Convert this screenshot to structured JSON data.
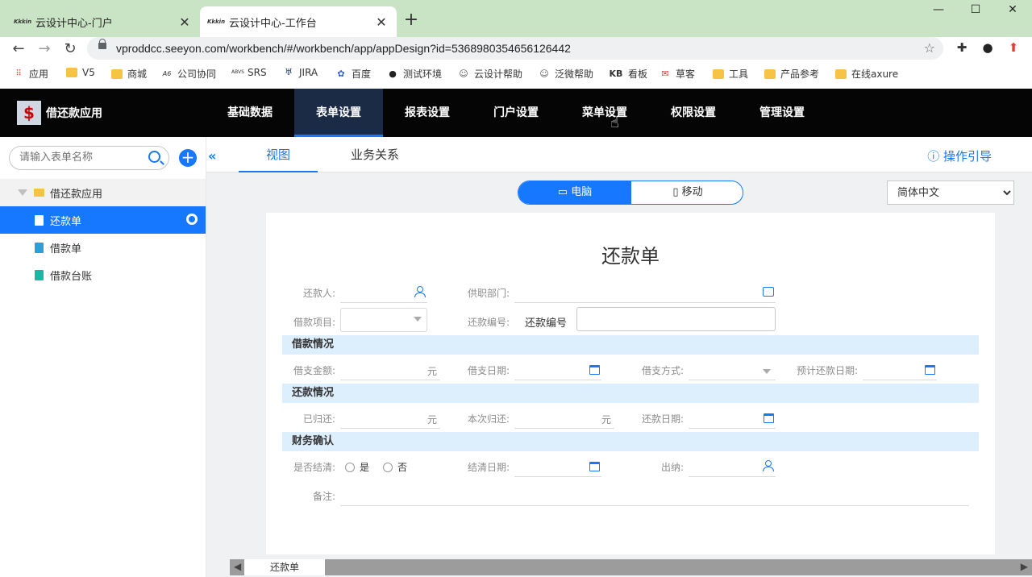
{
  "browser": {
    "tabs": [
      {
        "favicon": "Kkkin",
        "title": "云设计中心-门户",
        "active": false
      },
      {
        "favicon": "Kkkin",
        "title": "云设计中心-工作台",
        "active": true
      }
    ],
    "url": "vproddcc.seeyon.com/workbench/#/workbench/app/appDesign?id=5368980354656126442",
    "bookmarks": [
      {
        "icon": "apps-grid-icon",
        "label": "应用"
      },
      {
        "icon": "folder-icon",
        "label": "V5"
      },
      {
        "icon": "folder-icon",
        "label": "商城"
      },
      {
        "icon": "a6-icon",
        "label": "公司协同"
      },
      {
        "icon": "srs-icon",
        "label": "SRS"
      },
      {
        "icon": "jira-icon",
        "label": "JIRA"
      },
      {
        "icon": "baidu-icon",
        "label": "百度"
      },
      {
        "icon": "globe-icon",
        "label": "测试环境"
      },
      {
        "icon": "help-icon",
        "label": "云设计帮助"
      },
      {
        "icon": "help-icon",
        "label": "泛微帮助"
      },
      {
        "icon": "kb-icon",
        "label": "看板"
      },
      {
        "icon": "mail-icon",
        "label": "草客"
      },
      {
        "icon": "folder-icon",
        "label": "工具"
      },
      {
        "icon": "folder-icon",
        "label": "产品参考"
      },
      {
        "icon": "folder-icon",
        "label": "在线axure"
      }
    ]
  },
  "app": {
    "logo_glyph": "$",
    "name": "借还款应用",
    "nav": [
      {
        "label": "基础数据",
        "active": false
      },
      {
        "label": "表单设置",
        "active": true
      },
      {
        "label": "报表设置",
        "active": false
      },
      {
        "label": "门户设置",
        "active": false
      },
      {
        "label": "菜单设置",
        "active": false
      },
      {
        "label": "权限设置",
        "active": false
      },
      {
        "label": "管理设置",
        "active": false
      }
    ]
  },
  "sidebar": {
    "search_placeholder": "请输入表单名称",
    "root": "借还款应用",
    "items": [
      {
        "label": "还款单",
        "selected": true
      },
      {
        "label": "借款单",
        "selected": false
      },
      {
        "label": "借款台账",
        "selected": false
      }
    ]
  },
  "main": {
    "tabs": [
      {
        "label": "视图",
        "active": true
      },
      {
        "label": "业务关系",
        "active": false
      }
    ],
    "guide": "操作引导",
    "device": {
      "pc": "电脑",
      "mobile": "移动"
    },
    "language": "简体中文"
  },
  "form": {
    "title": "还款单",
    "labels": {
      "repayer": "还款人:",
      "dept": "供职部门:",
      "loan_item": "借款项目:",
      "repay_no": "还款编号:",
      "repay_no_inline": "还款编号",
      "borrow_amount": "借支金额:",
      "borrow_date": "借支日期:",
      "borrow_method": "借支方式:",
      "expected_date": "预计还款日期:",
      "returned": "已归还:",
      "this_return": "本次归还:",
      "repay_date": "还款日期:",
      "settled": "是否结清:",
      "settle_date": "结清日期:",
      "cashier": "出纳:",
      "remark": "备注:"
    },
    "sections": [
      "借款情况",
      "还款情况",
      "财务确认"
    ],
    "unit": "元",
    "radio_yes": "是",
    "radio_no": "否"
  },
  "bottom": {
    "sheet": "还款单"
  },
  "colors": {
    "accent": "#1677ff",
    "header": "#050505",
    "section": "#ddeefc",
    "tabstrip": "#c9e4c4"
  }
}
